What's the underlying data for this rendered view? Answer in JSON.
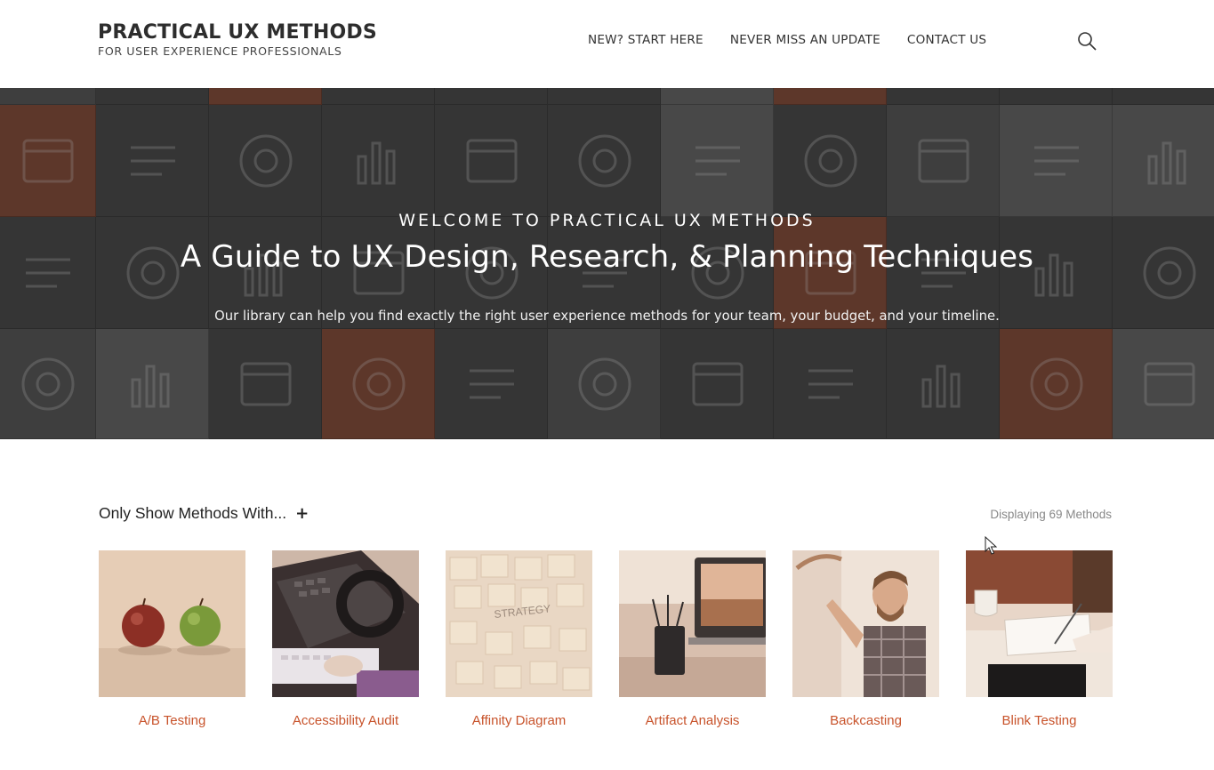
{
  "header": {
    "title": "PRACTICAL UX METHODS",
    "subtitle": "FOR USER EXPERIENCE PROFESSIONALS",
    "nav": [
      "NEW? START HERE",
      "NEVER MISS AN UPDATE",
      "CONTACT US"
    ],
    "search_icon": "search-icon"
  },
  "hero": {
    "kicker": "WELCOME TO PRACTICAL UX METHODS",
    "title": "A Guide to UX Design, Research, & Planning Techniques",
    "text": "Our library can help you find exactly the right user experience methods for your team, your budget, and your timeline."
  },
  "filter": {
    "label": "Only Show Methods With...",
    "toggle": "+",
    "count": "Displaying 69 Methods"
  },
  "methods": [
    {
      "label": "A/B Testing"
    },
    {
      "label": "Accessibility Audit"
    },
    {
      "label": "Affinity Diagram"
    },
    {
      "label": "Artifact Analysis"
    },
    {
      "label": "Backcasting"
    },
    {
      "label": "Blink Testing"
    }
  ],
  "colors": {
    "accent": "#c8532b",
    "hero_tile_dark": "#3d3d3d",
    "hero_tile_mid": "#4b4b4b",
    "hero_tile_light": "#5a5a5a",
    "hero_tile_orange": "#7a3f2b"
  }
}
